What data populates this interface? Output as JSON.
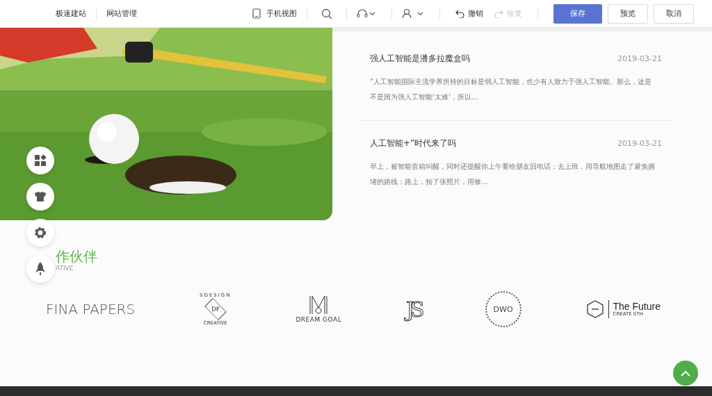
{
  "topbar": {
    "left_links": [
      "极速建站",
      "网站管理"
    ],
    "mobile_view": "手机视图",
    "undo": {
      "label": "撤销",
      "disabled": false
    },
    "redo": {
      "label": "恢复",
      "disabled": true
    },
    "buttons": [
      {
        "label": "保存",
        "primary": true
      },
      {
        "label": "预览",
        "primary": false
      },
      {
        "label": "取消",
        "primary": false
      }
    ]
  },
  "articles": [
    {
      "title": "强人工智能是潘多拉魔盒吗",
      "date": "2019-03-21",
      "summary": "“人工智能国际主流学界所持的目标是弱人工智能，也少有人致力于强人工智能。那么，这是不是因为强人工智能‘太难’，所以..."
    },
    {
      "title": "人工智能+”时代来了吗",
      "date": "2019-03-21",
      "summary": "早上，被智能音箱叫醒，同时还提醒你上午要给朋友回电话；去上班，用导航地图走了避免拥堵的路线；路上，拍了张照片，用修..."
    }
  ],
  "float_tools": [
    {
      "kind": "widgets"
    },
    {
      "kind": "shirt"
    },
    {
      "kind": "gear"
    },
    {
      "kind": "rocket"
    }
  ],
  "partners": {
    "title": "作伙伴",
    "subtitle": "ATIVE",
    "logos": [
      {
        "kind": "fina",
        "lines": [
          "FINA PAPERS"
        ]
      },
      {
        "kind": "sdesign",
        "lines": [
          "SDESIGN",
          "DF",
          "CREATIVE"
        ]
      },
      {
        "kind": "dream",
        "lines": [
          "DREAM GOAL"
        ]
      },
      {
        "kind": "js",
        "lines": [
          "JS"
        ]
      },
      {
        "kind": "dwo",
        "lines": [
          "DWO"
        ]
      },
      {
        "kind": "future",
        "lines": [
          "The Future",
          "CREATE STH"
        ]
      }
    ]
  }
}
